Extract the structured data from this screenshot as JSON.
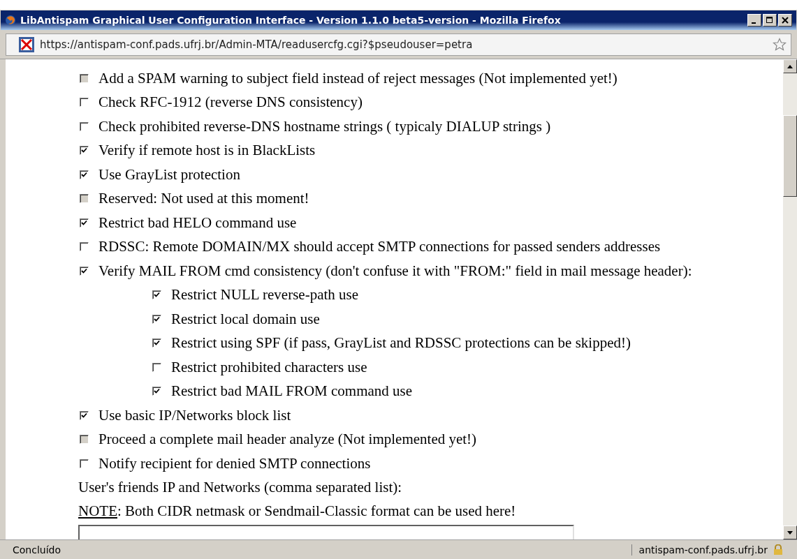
{
  "window": {
    "title": "LibAntispam Graphical User Configuration Interface - Version 1.1.0 beta5-version - Mozilla Firefox"
  },
  "address_bar": {
    "url": "https://antispam-conf.pads.ufrj.br/Admin-MTA/readusercfg.cgi?$pseudouser=petra"
  },
  "options": [
    {
      "label": "Add a SPAM warning to subject field instead of reject messages (Not implemented yet!)",
      "checked": false,
      "disabled": true
    },
    {
      "label": "Check RFC-1912 (reverse DNS consistency)",
      "checked": false,
      "disabled": false
    },
    {
      "label": "Check prohibited reverse-DNS hostname strings ( typicaly DIALUP strings )",
      "checked": false,
      "disabled": false
    },
    {
      "label": "Verify if remote host is in BlackLists",
      "checked": true,
      "disabled": false
    },
    {
      "label": "Use GrayList protection",
      "checked": true,
      "disabled": false
    },
    {
      "label": "Reserved: Not used at this moment!",
      "checked": false,
      "disabled": true
    },
    {
      "label": "Restrict bad HELO command use",
      "checked": true,
      "disabled": false
    },
    {
      "label": "RDSSC: Remote DOMAIN/MX should accept SMTP connections for passed senders addresses",
      "checked": false,
      "disabled": false
    },
    {
      "label": "Verify MAIL FROM cmd consistency (don't confuse it with \"FROM:\" field in mail message header):",
      "checked": true,
      "disabled": false,
      "children": [
        {
          "label": "Restrict NULL reverse-path use",
          "checked": true,
          "disabled": false
        },
        {
          "label": "Restrict local domain use",
          "checked": true,
          "disabled": false
        },
        {
          "label": "Restrict using SPF (if pass, GrayList and RDSSC protections can be skipped!)",
          "checked": true,
          "disabled": false
        },
        {
          "label": "Restrict prohibited characters use",
          "checked": false,
          "disabled": false
        },
        {
          "label": "Restrict bad MAIL FROM command use",
          "checked": true,
          "disabled": false
        }
      ]
    },
    {
      "label": "Use basic IP/Networks block list",
      "checked": true,
      "disabled": false
    },
    {
      "label": "Proceed a complete mail header analyze (Not implemented yet!)",
      "checked": false,
      "disabled": true
    },
    {
      "label": "Notify recipient for denied SMTP connections",
      "checked": false,
      "disabled": false
    }
  ],
  "friends_label": "User's friends IP and Networks (comma separated list):",
  "note": {
    "label": "NOTE",
    "text": ": Both CIDR netmask or Sendmail-Classic format can be used here!"
  },
  "status_bar": {
    "status": "Concluído",
    "host": "antispam-conf.pads.ufrj.br"
  }
}
